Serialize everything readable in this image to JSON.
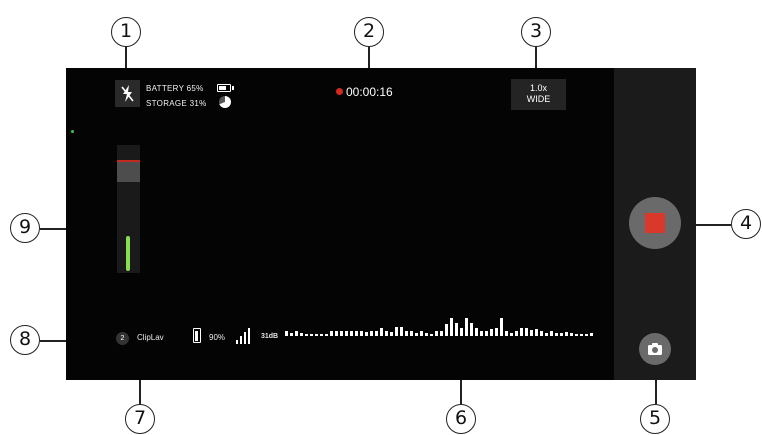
{
  "callouts": [
    "1",
    "2",
    "3",
    "4",
    "5",
    "6",
    "7",
    "8",
    "9"
  ],
  "status": {
    "battery_label": "BATTERY 65%",
    "battery_level": 0.65,
    "storage_label": "STORAGE 31%",
    "storage_level": 0.31
  },
  "recording": {
    "timer": "00:00:16",
    "rec_color": "#d32a20"
  },
  "zoom": {
    "level": "1.0x",
    "lens": "WIDE"
  },
  "audio_level": {
    "level": 0.27,
    "peak_color": "#c22a20",
    "level_color": "#8bdd52"
  },
  "mic": {
    "channel": "2",
    "name": "ClipLav",
    "battery": "90%",
    "battery_level": 0.9,
    "signal_bars": 4,
    "db": "31dB"
  },
  "waveform": [
    1,
    0.5,
    1,
    0.5,
    0.3,
    0.3,
    0.3,
    0.4,
    0.3,
    1,
    1,
    1,
    1,
    1,
    1,
    1,
    0.8,
    1,
    1,
    1.6,
    1,
    0.8,
    1.8,
    1.8,
    1,
    1,
    0.5,
    1,
    0.6,
    0.3,
    1,
    1,
    2.3,
    3.6,
    2.6,
    1.5,
    3.5,
    2.6,
    1.5,
    1,
    1,
    1.3,
    1.5,
    3.6,
    1,
    0.5,
    1,
    1.6,
    1.6,
    1.1,
    1.3,
    1,
    0.6,
    1,
    0.6,
    0.6,
    0.8,
    0.6,
    0.4,
    0.3,
    0.3,
    0.5
  ]
}
